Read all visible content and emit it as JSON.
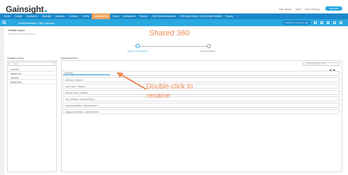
{
  "logo": {
    "text": "Gainsight"
  },
  "toplinks": [
    "Kate Jackson",
    "Admin",
    "Help & Training"
  ],
  "gs_button": "Gainsight",
  "nav": {
    "items": [
      "Home",
      "Cockpit",
      "Customers",
      "Gainsight",
      "Accounts",
      "Contacts",
      "CoPilot",
      "Administration",
      "Cases",
      "Dashboards",
      "Reports",
      "CSM Client Interactions",
      "CSM Action Items | Scm Review/Priorities",
      "Survey",
      "+"
    ],
    "active_index": 7
  },
  "header": {
    "app_icon": "G",
    "title": "Administration / 360 Layouts",
    "user": "Customer name kate sait"
  },
  "layout": {
    "name": "Default Layout",
    "description": "Add Description of the layout here"
  },
  "watermark": "Shared 360",
  "steps": [
    {
      "num": "1",
      "label": "Section configurations"
    },
    {
      "num": "2",
      "label": "Sharing settings"
    }
  ],
  "available": {
    "label": "Available sections",
    "search_placeholder": "Search...",
    "items": [
      "Summary",
      "Related List",
      "Attributes",
      "Relationship"
    ]
  },
  "selected": {
    "label": "Selected sections",
    "search_placeholder": "Search by section name",
    "rename_value": "Summary",
    "rows": [
      "Attributes - Relation",
      "Open Cases - Relation",
      "Museum Game - Relation",
      "Core Utilization - External Report",
      "Learning Utilization - External Report",
      "Engagement Activity - External Report"
    ]
  },
  "callout": {
    "line1": "Double-click to",
    "line2": "rename"
  },
  "colors": {
    "nav": "#1c87c9",
    "header": "#2aa8e0",
    "active": "#f1a35d",
    "annotation": "#f08a58"
  }
}
